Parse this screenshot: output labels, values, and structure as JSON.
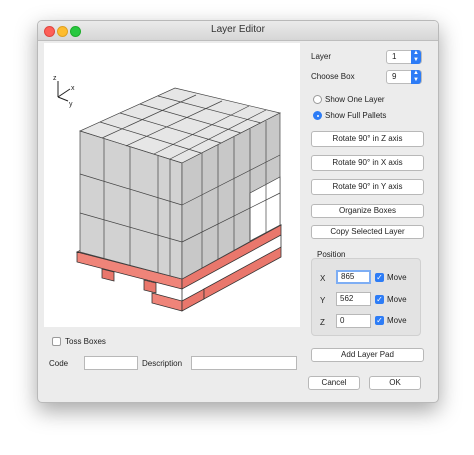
{
  "window": {
    "title": "Layer Editor"
  },
  "axes": {
    "z": "z",
    "x": "x",
    "y": "y"
  },
  "layer": {
    "label": "Layer",
    "value": "1"
  },
  "choose_box": {
    "label": "Choose Box",
    "value": "9"
  },
  "view_mode": {
    "options": [
      {
        "label": "Show One Layer",
        "selected": false
      },
      {
        "label": "Show Full Pallets",
        "selected": true
      }
    ]
  },
  "buttons": {
    "rotate_z": "Rotate 90° in Z axis",
    "rotate_x": "Rotate 90° in X axis",
    "rotate_y": "Rotate 90° in Y axis",
    "organize": "Organize Boxes",
    "copy_layer": "Copy Selected Layer",
    "add_pad": "Add Layer Pad",
    "cancel": "Cancel",
    "ok": "OK"
  },
  "position": {
    "title": "Position",
    "x": {
      "label": "X",
      "value": "865",
      "move_label": "Move",
      "move": true
    },
    "y": {
      "label": "Y",
      "value": "562",
      "move_label": "Move",
      "move": true
    },
    "z": {
      "label": "Z",
      "value": "0",
      "move_label": "Move",
      "move": true
    }
  },
  "toss_boxes": {
    "label": "Toss Boxes",
    "checked": false
  },
  "code": {
    "label": "Code",
    "value": ""
  },
  "description": {
    "label": "Description",
    "value": ""
  },
  "colors": {
    "accent": "#2d7cf6",
    "pallet": "#f08a80",
    "box": "#d9d9d9"
  }
}
